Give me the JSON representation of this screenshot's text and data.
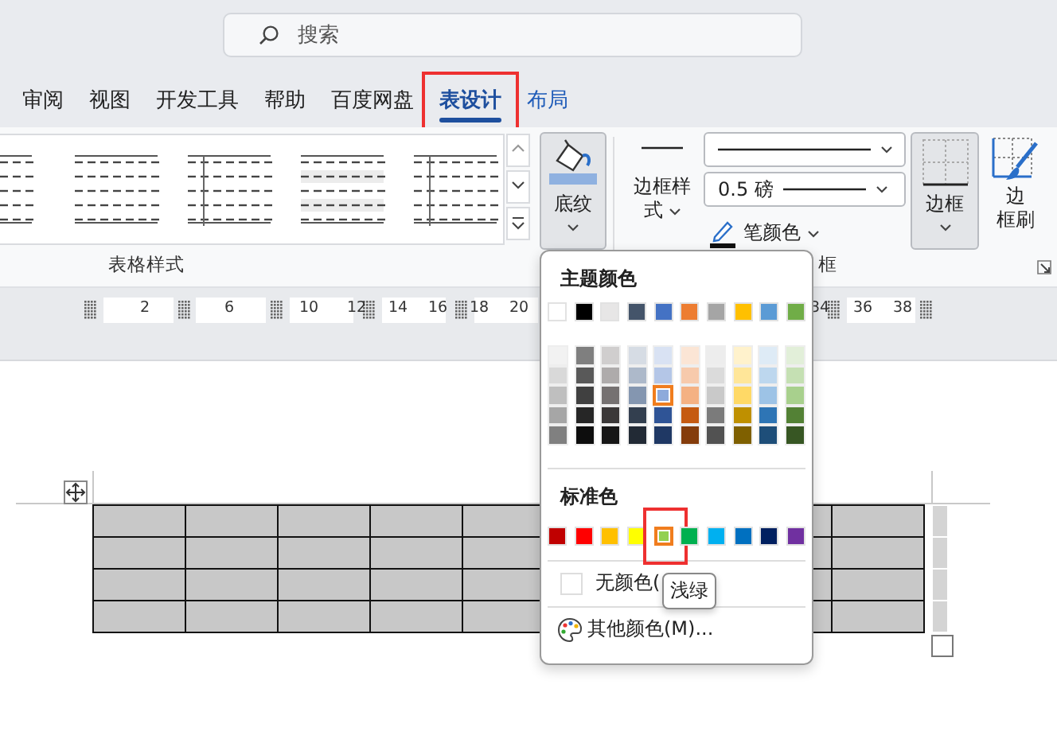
{
  "search": {
    "placeholder": "搜索"
  },
  "tabs": [
    {
      "label": "审阅",
      "kind": "standard",
      "selected": false,
      "annotated": false
    },
    {
      "label": "视图",
      "kind": "standard",
      "selected": false,
      "annotated": false
    },
    {
      "label": "开发工具",
      "kind": "standard",
      "selected": false,
      "annotated": false
    },
    {
      "label": "帮助",
      "kind": "standard",
      "selected": false,
      "annotated": false
    },
    {
      "label": "百度网盘",
      "kind": "standard",
      "selected": false,
      "annotated": false
    },
    {
      "label": "表设计",
      "kind": "contextual",
      "selected": true,
      "annotated": true
    },
    {
      "label": "布局",
      "kind": "contextual",
      "selected": false,
      "annotated": false
    }
  ],
  "ribbon": {
    "table_styles_label": "表格样式",
    "shading_button": {
      "label": "底纹",
      "pressed": true
    },
    "border_style_button": {
      "label": "边框样式"
    },
    "line_weight": {
      "value": "0.5 磅"
    },
    "pen_color_button": {
      "label": "笔颜色"
    },
    "borders_button": {
      "label": "边框",
      "pressed": true
    },
    "border_painter_button": {
      "label_lines": [
        "边",
        "框刷"
      ]
    },
    "borders_group_label": "框"
  },
  "ruler": {
    "labels": [
      "2",
      "6",
      "10",
      "12",
      "14",
      "16",
      "18",
      "20",
      "34",
      "36",
      "38"
    ]
  },
  "shading_menu": {
    "theme_title": "主题颜色",
    "theme_colors": [
      {
        "color": "#ffffff",
        "selected": false,
        "shades": [
          {
            "color": "#f2f2f2",
            "selected": false
          },
          {
            "color": "#d9d9d9",
            "selected": false
          },
          {
            "color": "#bfbfbf",
            "selected": false
          },
          {
            "color": "#a6a6a6",
            "selected": false
          },
          {
            "color": "#808080",
            "selected": false
          }
        ]
      },
      {
        "color": "#000000",
        "selected": false,
        "shades": [
          {
            "color": "#7f7f7f",
            "selected": false
          },
          {
            "color": "#595959",
            "selected": false
          },
          {
            "color": "#404040",
            "selected": false
          },
          {
            "color": "#262626",
            "selected": false
          },
          {
            "color": "#0d0d0d",
            "selected": false
          }
        ]
      },
      {
        "color": "#e7e6e6",
        "selected": false,
        "shades": [
          {
            "color": "#d0cece",
            "selected": false
          },
          {
            "color": "#aeabab",
            "selected": false
          },
          {
            "color": "#757171",
            "selected": false
          },
          {
            "color": "#3b3838",
            "selected": false
          },
          {
            "color": "#171616",
            "selected": false
          }
        ]
      },
      {
        "color": "#44546a",
        "selected": false,
        "shades": [
          {
            "color": "#d6dce4",
            "selected": false
          },
          {
            "color": "#adb9ca",
            "selected": false
          },
          {
            "color": "#8496b0",
            "selected": false
          },
          {
            "color": "#333f4f",
            "selected": false
          },
          {
            "color": "#222a35",
            "selected": false
          }
        ]
      },
      {
        "color": "#4472c4",
        "selected": false,
        "shades": [
          {
            "color": "#d9e2f3",
            "selected": false
          },
          {
            "color": "#b4c6e7",
            "selected": false
          },
          {
            "color": "#8eaadb",
            "selected": true
          },
          {
            "color": "#2f5496",
            "selected": false
          },
          {
            "color": "#1f3864",
            "selected": false
          }
        ]
      },
      {
        "color": "#ed7d31",
        "selected": false,
        "shades": [
          {
            "color": "#fbe5d5",
            "selected": false
          },
          {
            "color": "#f7caac",
            "selected": false
          },
          {
            "color": "#f4b183",
            "selected": false
          },
          {
            "color": "#c55a11",
            "selected": false
          },
          {
            "color": "#843c0b",
            "selected": false
          }
        ]
      },
      {
        "color": "#a5a5a5",
        "selected": false,
        "shades": [
          {
            "color": "#ededed",
            "selected": false
          },
          {
            "color": "#dbdbdb",
            "selected": false
          },
          {
            "color": "#c9c9c9",
            "selected": false
          },
          {
            "color": "#7b7b7b",
            "selected": false
          },
          {
            "color": "#525252",
            "selected": false
          }
        ]
      },
      {
        "color": "#ffc000",
        "selected": false,
        "shades": [
          {
            "color": "#fff2cc",
            "selected": false
          },
          {
            "color": "#ffe699",
            "selected": false
          },
          {
            "color": "#ffd966",
            "selected": false
          },
          {
            "color": "#bf9000",
            "selected": false
          },
          {
            "color": "#7f6000",
            "selected": false
          }
        ]
      },
      {
        "color": "#5b9bd5",
        "selected": false,
        "shades": [
          {
            "color": "#deebf6",
            "selected": false
          },
          {
            "color": "#bdd7ee",
            "selected": false
          },
          {
            "color": "#9dc3e6",
            "selected": false
          },
          {
            "color": "#2e75b5",
            "selected": false
          },
          {
            "color": "#1e4e79",
            "selected": false
          }
        ]
      },
      {
        "color": "#70ad47",
        "selected": false,
        "shades": [
          {
            "color": "#e2efd9",
            "selected": false
          },
          {
            "color": "#c5e0b3",
            "selected": false
          },
          {
            "color": "#a8d08d",
            "selected": false
          },
          {
            "color": "#538135",
            "selected": false
          },
          {
            "color": "#375623",
            "selected": false
          }
        ]
      }
    ],
    "standard_title": "标准色",
    "standard_colors": [
      {
        "color": "#c00000",
        "selected": false,
        "annotated": false
      },
      {
        "color": "#ff0000",
        "selected": false,
        "annotated": false
      },
      {
        "color": "#ffc000",
        "selected": false,
        "annotated": false
      },
      {
        "color": "#ffff00",
        "selected": false,
        "annotated": false
      },
      {
        "color": "#92d050",
        "selected": true,
        "annotated": true
      },
      {
        "color": "#00b050",
        "selected": false,
        "annotated": false
      },
      {
        "color": "#00b0f0",
        "selected": false,
        "annotated": false
      },
      {
        "color": "#0070c0",
        "selected": false,
        "annotated": false
      },
      {
        "color": "#002060",
        "selected": false,
        "annotated": false
      },
      {
        "color": "#7030a0",
        "selected": false,
        "annotated": false
      }
    ],
    "no_color": "无颜色(",
    "more_colors": "其他颜色(M)...",
    "tooltip": "浅绿"
  },
  "table": {
    "shaded": true
  }
}
